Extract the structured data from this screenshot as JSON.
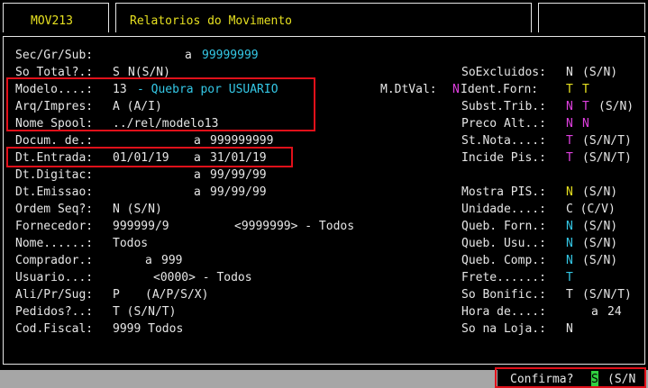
{
  "tabs": {
    "code": "MOV213",
    "title": "Relatorios do Movimento"
  },
  "fields": {
    "secgrsub": {
      "label": "Sec/Gr/Sub:",
      "sep": "a",
      "value": "99999999"
    },
    "sototal": {
      "label": "So Total?.:",
      "value": "S",
      "opts": "N(S/N)"
    },
    "soexcluidos": {
      "label": "SoExcluidos:",
      "value": "N",
      "opts": "(S/N)"
    },
    "modelo": {
      "label": "Modelo....:",
      "num": "13",
      "desc": "- Quebra por USUARIO"
    },
    "mdtval": {
      "label": "M.DtVal:",
      "value": "N"
    },
    "identforn": {
      "label": "Ident.Forn:",
      "v1": "T",
      "v2": "T"
    },
    "arqimpres": {
      "label": "Arq/Impres:",
      "value": "A (A/I)"
    },
    "substtrib": {
      "label": "Subst.Trib.:",
      "v1": "N",
      "v2": "T",
      "opts": "(S/N)"
    },
    "nomespool": {
      "label": "Nome Spool:",
      "value": "../rel/modelo13"
    },
    "precoalt": {
      "label": "Preco Alt..:",
      "v1": "N",
      "v2": "N"
    },
    "docum": {
      "label": "Docum. de.:",
      "sep": "a",
      "value": "999999999"
    },
    "stnota": {
      "label": "St.Nota....:",
      "value": "T",
      "opts": "(S/N/T)"
    },
    "dtentrada": {
      "label": "Dt.Entrada:",
      "from": "01/01/19",
      "sep": "a",
      "to": "31/01/19"
    },
    "incidepis": {
      "label": "Incide Pis.:",
      "value": "T",
      "opts": "(S/N/T)"
    },
    "dtdigitac": {
      "label": "Dt.Digitac:",
      "sep": "a",
      "value": "99/99/99"
    },
    "dtemissao": {
      "label": "Dt.Emissao:",
      "sep": "a",
      "value": "99/99/99"
    },
    "mostrapis": {
      "label": "Mostra PIS.:",
      "value": "N",
      "opts": "(S/N)"
    },
    "ordemseq": {
      "label": "Ordem Seq?:",
      "value": "N (S/N)"
    },
    "unidade": {
      "label": "Unidade....:",
      "value": "C (C/V)"
    },
    "fornecedor": {
      "label": "Fornecedor:",
      "value": "999999/9",
      "range": "<9999999> - Todos"
    },
    "quebforn": {
      "label": "Queb. Forn.:",
      "value": "N",
      "opts": "(S/N)"
    },
    "nome": {
      "label": "Nome......:",
      "value": "Todos"
    },
    "quebusu": {
      "label": "Queb. Usu..:",
      "value": "N",
      "opts": "(S/N)"
    },
    "comprador": {
      "label": "Comprador.:",
      "sep": "a",
      "value": "999"
    },
    "quebcomp": {
      "label": "Queb. Comp.:",
      "value": "N",
      "opts": "(S/N)"
    },
    "usuario": {
      "label": "Usuario...:",
      "value": "<0000> - Todos"
    },
    "frete": {
      "label": "Frete......:",
      "value": "T"
    },
    "aliprsug": {
      "label": "Ali/Pr/Sug:",
      "value": "P",
      "opts": "(A/P/S/X)"
    },
    "sobonific": {
      "label": "So Bonific.:",
      "value": "T",
      "opts": "(S/N/T)"
    },
    "pedidos": {
      "label": "Pedidos?..:",
      "value": "T (S/N/T)"
    },
    "horade": {
      "label": "Hora de....:",
      "sep": "a",
      "value": "24"
    },
    "codfiscal": {
      "label": "Cod.Fiscal:",
      "value": "9999 Todos"
    },
    "sonaloja": {
      "label": "So na Loja.:",
      "value": "N"
    }
  },
  "prompt": {
    "question": "Confirma?",
    "answer": "S",
    "opts": "(S/N"
  },
  "colors": {
    "label": "#e6e6e6",
    "value": "#34c8e6",
    "yellow": "#e6e020",
    "magenta": "#e040e0",
    "green": "#30d040",
    "highlight": "#e0101a",
    "statusbar": "#a6a6a6"
  }
}
